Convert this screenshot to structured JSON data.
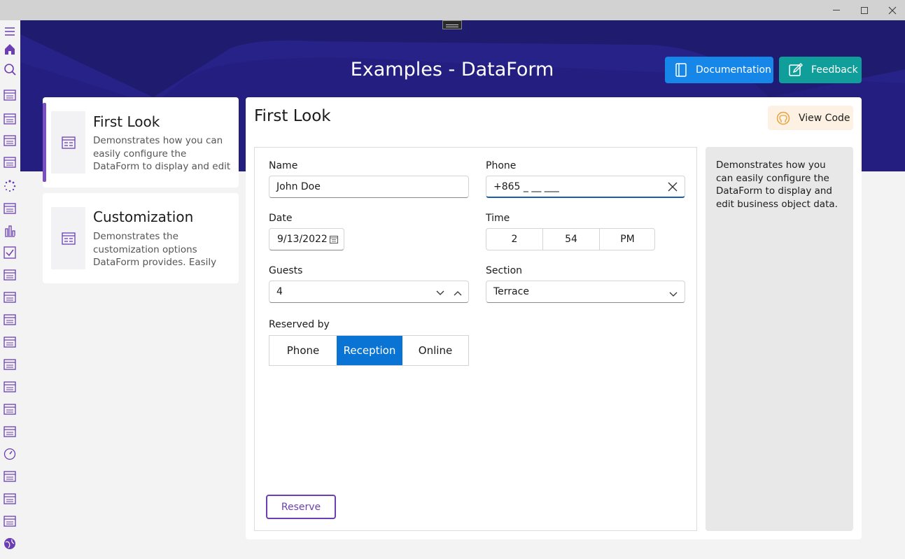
{
  "window": {
    "minimize_icon": "minimize-icon",
    "maximize_icon": "maximize-icon",
    "close_icon": "close-icon"
  },
  "colors": {
    "banner": "#1f1b6e",
    "accent": "#7a4fc2",
    "documentation": "#1686e8",
    "feedback": "#0f9e9a",
    "selected_segment": "#0a74d4"
  },
  "sidebar": {
    "icons": [
      "hamburger-menu-icon",
      "home-icon",
      "search-icon",
      "autocomplete-icon",
      "badge-icon",
      "barcode-icon",
      "border-icon",
      "busy-indicator-icon",
      "button-icon",
      "chart-icon",
      "checkbox-icon",
      "collectionview-icon",
      "dataform-icon",
      "datagrid-icon",
      "dataform-grid-icon",
      "datetimepicker-icon",
      "dockinglayout-icon",
      "entry-icon",
      "expander-icon",
      "gauge-icon",
      "listview-icon",
      "navigationview-icon",
      "listpicker-icon",
      "globe-icon"
    ]
  },
  "header": {
    "title": "Examples - DataForm",
    "documentation_label": "Documentation",
    "feedback_label": "Feedback"
  },
  "examples": [
    {
      "title": "First Look",
      "description": "Demonstrates how you can easily configure the DataForm to display and edit business object data."
    },
    {
      "title": "Customization",
      "description": "Demonstrates the customization options DataForm provides. Easily style the editors and groups."
    }
  ],
  "main": {
    "title": "First Look",
    "view_code_label": "View Code",
    "description": "Demonstrates how you can easily configure the DataForm to display and edit business object data."
  },
  "form": {
    "name_label": "Name",
    "name_value": "John Doe",
    "phone_label": "Phone",
    "phone_value": "+865 _ __ ___",
    "date_label": "Date",
    "date_value": "9/13/2022",
    "time_label": "Time",
    "time_hour": "2",
    "time_minute": "54",
    "time_ampm": "PM",
    "guests_label": "Guests",
    "guests_value": "4",
    "section_label": "Section",
    "section_value": "Terrace",
    "reserved_label": "Reserved by",
    "reserved_options": [
      "Phone",
      "Reception",
      "Online"
    ],
    "reserved_selected": "Reception",
    "reserve_button": "Reserve"
  }
}
